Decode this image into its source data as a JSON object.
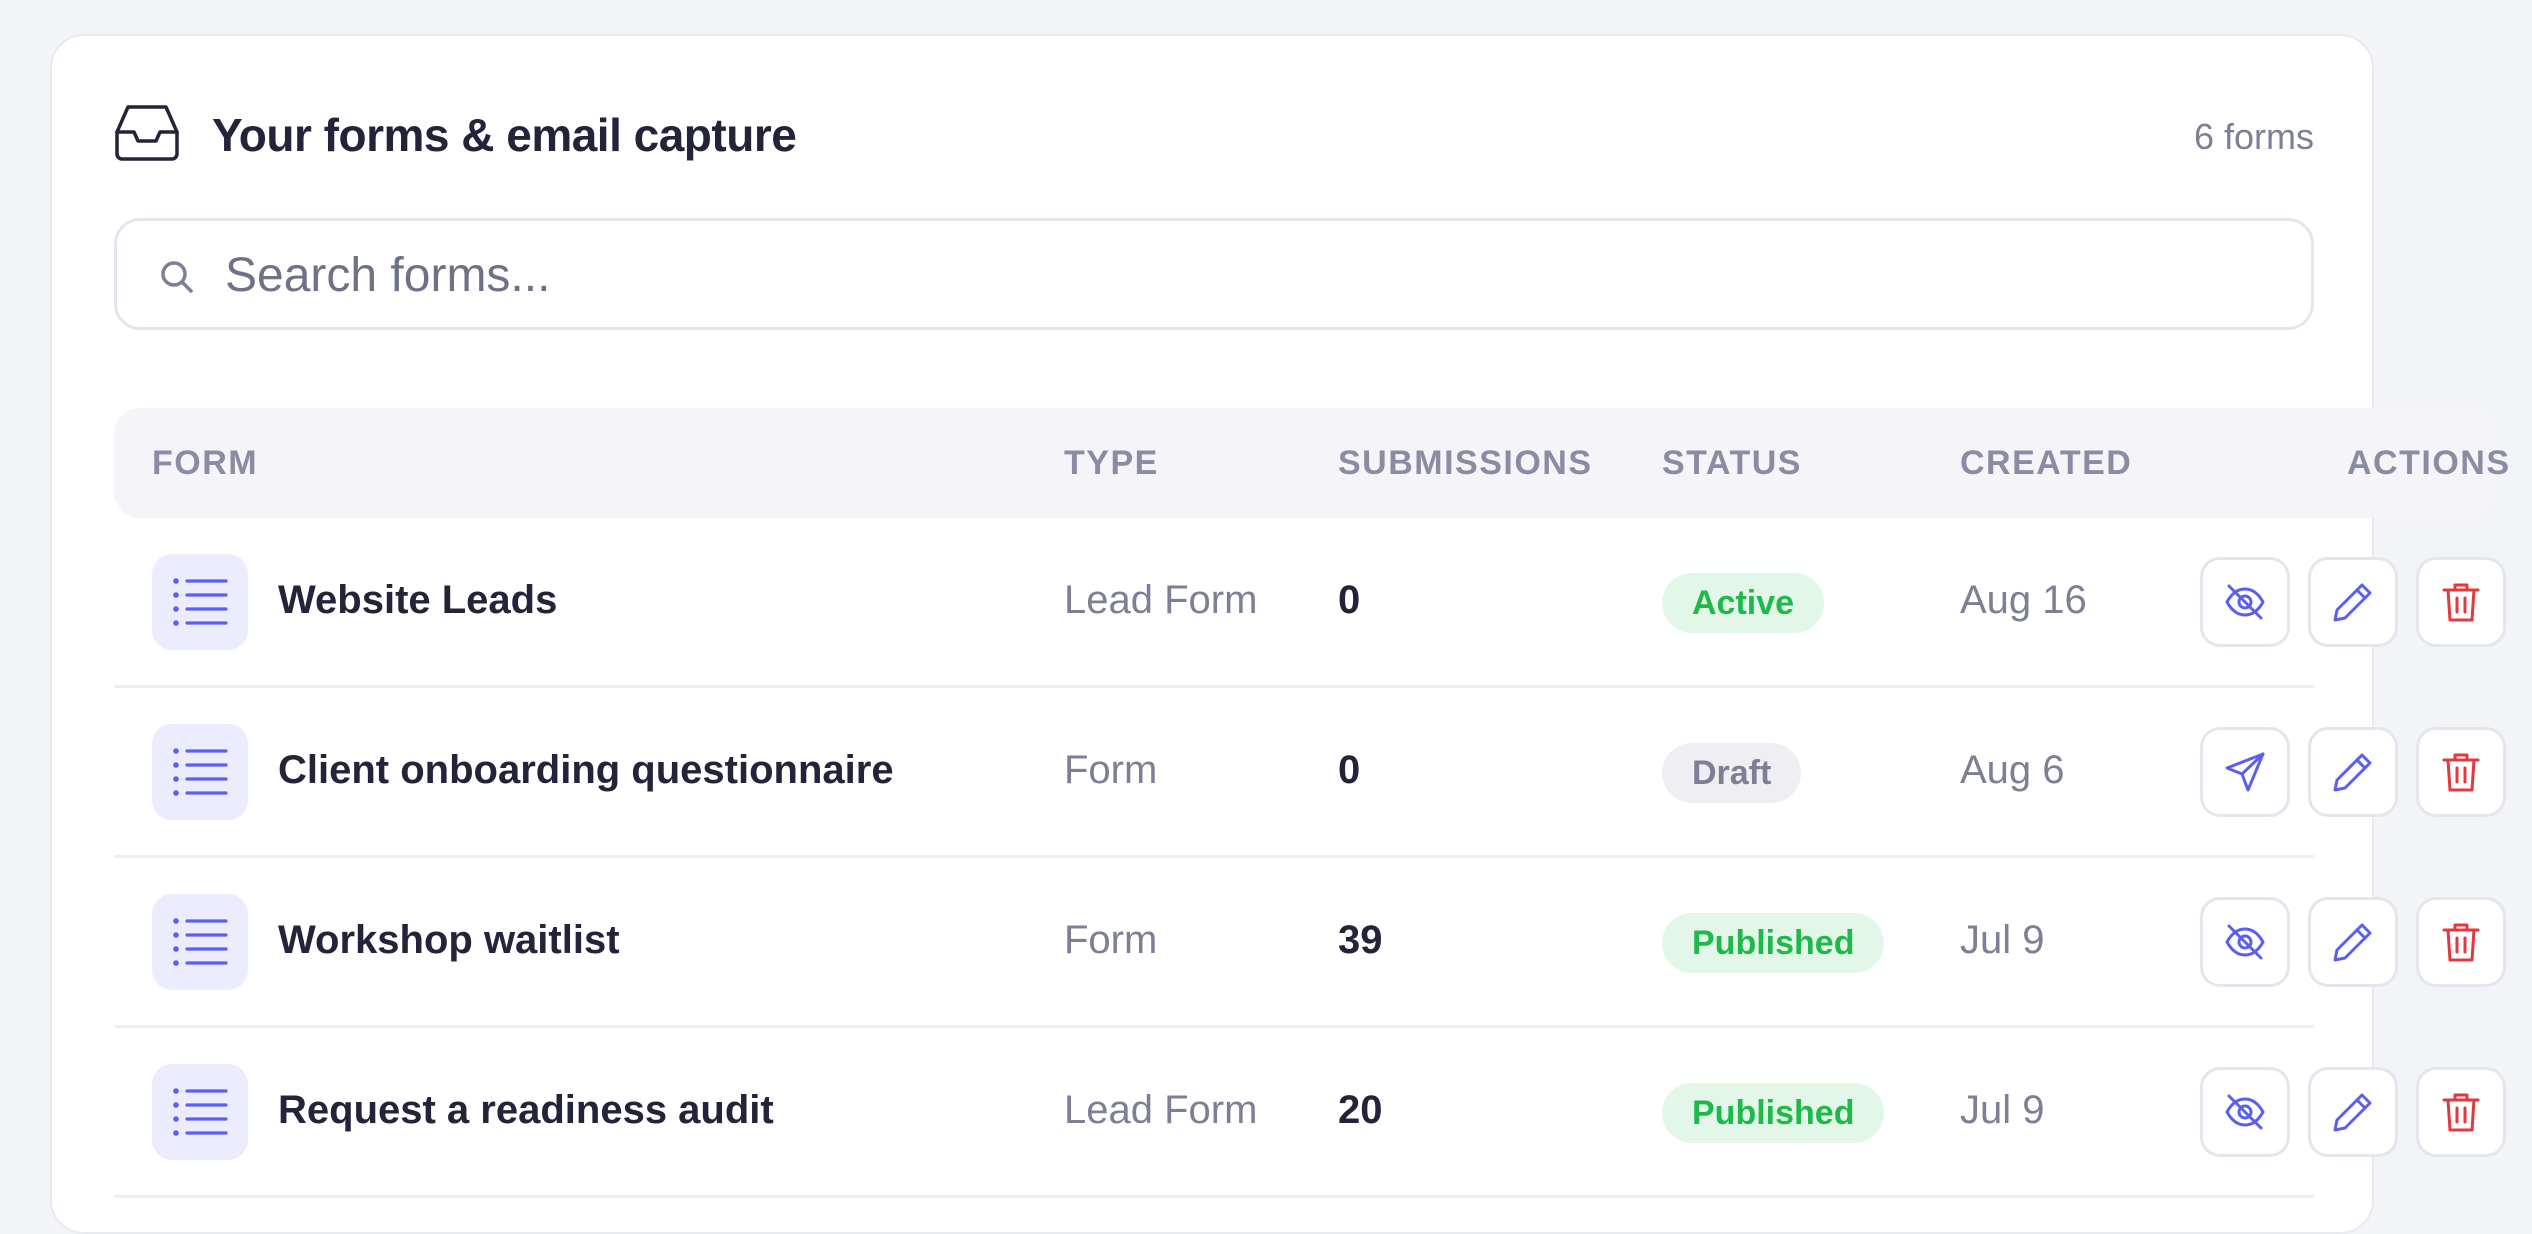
{
  "header": {
    "title": "Your forms & email capture",
    "count": "6 forms",
    "icon": "inbox-icon"
  },
  "search": {
    "placeholder": "Search forms...",
    "value": ""
  },
  "table": {
    "columns": [
      "FORM",
      "TYPE",
      "SUBMISSIONS",
      "STATUS",
      "CREATED",
      "ACTIONS"
    ],
    "rows": [
      {
        "name": "Website Leads",
        "type": "Lead Form",
        "submissions": "0",
        "status": "Active",
        "status_color": "#1fb94a",
        "created": "Aug 16",
        "primary_action": "hide-icon"
      },
      {
        "name": "Client onboarding questionnaire",
        "type": "Form",
        "submissions": "0",
        "status": "Draft",
        "status_color": "#7d7f94",
        "created": "Aug 6",
        "primary_action": "send-icon"
      },
      {
        "name": "Workshop waitlist",
        "type": "Form",
        "submissions": "39",
        "status": "Published",
        "status_color": "#1fb94a",
        "created": "Jul 9",
        "primary_action": "hide-icon"
      },
      {
        "name": "Request a readiness audit",
        "type": "Lead Form",
        "submissions": "20",
        "status": "Published",
        "status_color": "#1fb94a",
        "created": "Jul 9",
        "primary_action": "hide-icon"
      }
    ]
  },
  "colors": {
    "accent": "#5b5ff0",
    "danger": "#e0393e",
    "success": "#1fb94a"
  }
}
